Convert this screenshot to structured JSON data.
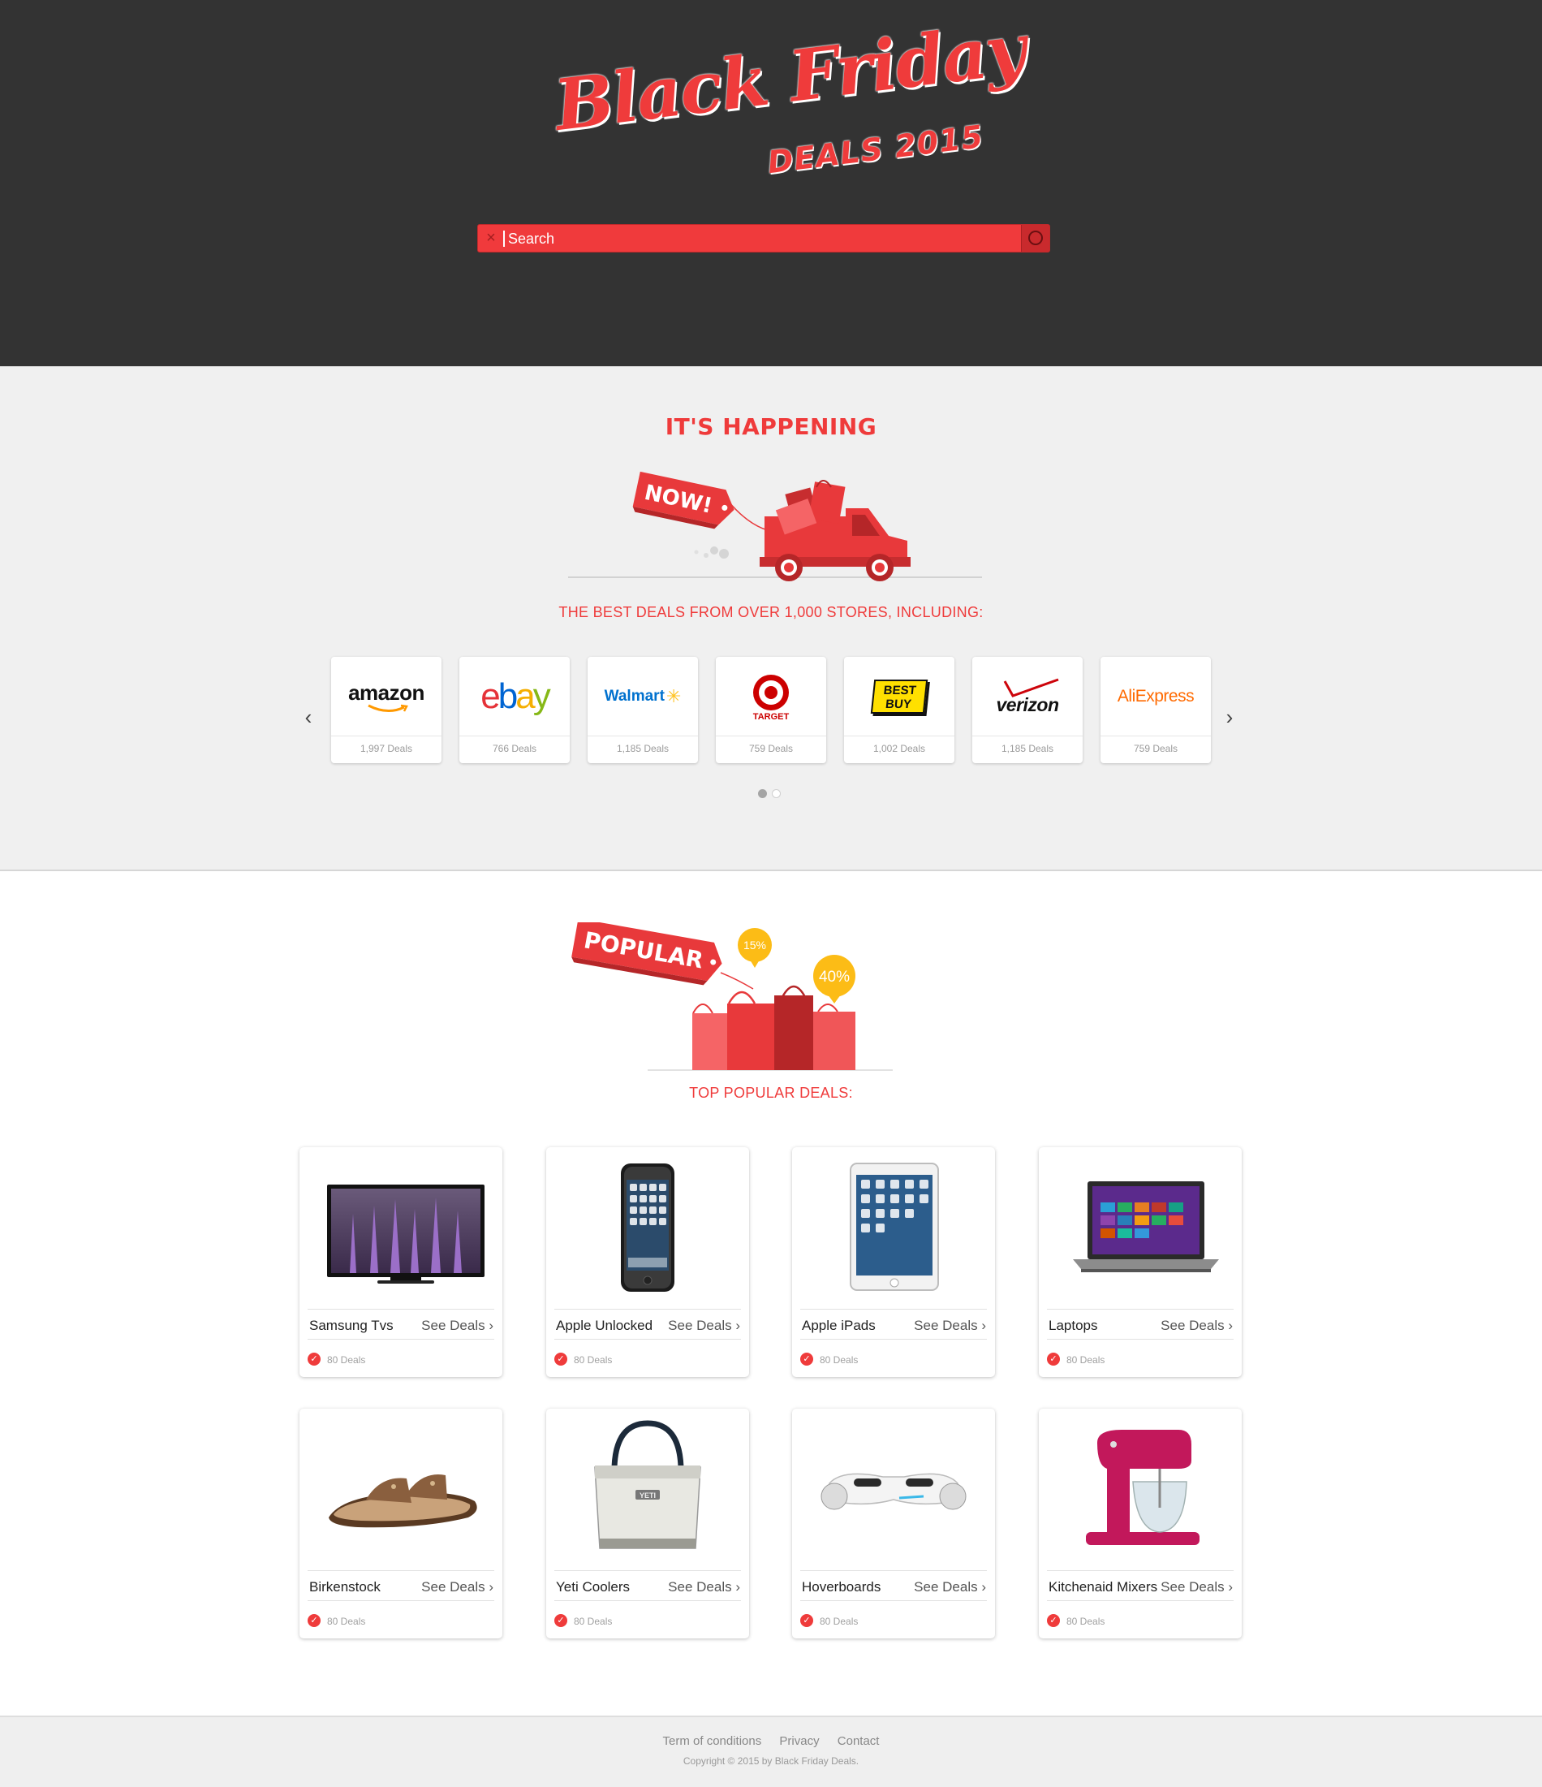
{
  "header": {
    "logo_title": "Black Friday",
    "logo_subtitle": "DEALS 2015",
    "search": {
      "placeholder": "Search"
    }
  },
  "stores_section": {
    "title": "IT'S HAPPENING",
    "badge": "NOW!",
    "subtitle": "THE BEST DEALS FROM OVER 1,000 STORES, INCLUDING:",
    "stores": [
      {
        "name": "amazon",
        "deals": "1,997 Deals"
      },
      {
        "name": "ebay",
        "deals": "766 Deals"
      },
      {
        "name": "Walmart",
        "deals": "1,185 Deals"
      },
      {
        "name": "TARGET",
        "deals": "759 Deals"
      },
      {
        "name": "BEST BUY",
        "deals": "1,002 Deals"
      },
      {
        "name": "verizon",
        "deals": "1,185 Deals"
      },
      {
        "name": "AliExpress",
        "deals": "759 Deals"
      }
    ],
    "pagination": {
      "pages": 2,
      "active": 1
    }
  },
  "popular_section": {
    "badge": "POPULAR",
    "discount_small": "15%",
    "discount_large": "40%",
    "subtitle": "TOP POPULAR DEALS:",
    "see_deals_label": "See Deals",
    "deals": [
      {
        "name": "Samsung Tvs",
        "count": "80 Deals",
        "icon": "tv"
      },
      {
        "name": "Apple Unlocked",
        "count": "80 Deals",
        "icon": "phone"
      },
      {
        "name": "Apple iPads",
        "count": "80 Deals",
        "icon": "tablet"
      },
      {
        "name": "Laptops",
        "count": "80 Deals",
        "icon": "laptop"
      },
      {
        "name": "Birkenstock",
        "count": "80 Deals",
        "icon": "sandal"
      },
      {
        "name": "Yeti Coolers",
        "count": "80 Deals",
        "icon": "cooler"
      },
      {
        "name": "Hoverboards",
        "count": "80 Deals",
        "icon": "hoverboard"
      },
      {
        "name": "Kitchenaid Mixers",
        "count": "80 Deals",
        "icon": "mixer"
      }
    ]
  },
  "footer": {
    "links": [
      "Term of conditions",
      "Privacy",
      "Contact"
    ],
    "copyright": "Copyright © 2015 by Black Friday Deals."
  },
  "colors": {
    "accent": "#ef3b3b",
    "header_bg": "#333333",
    "section_bg": "#f0f0f0"
  }
}
